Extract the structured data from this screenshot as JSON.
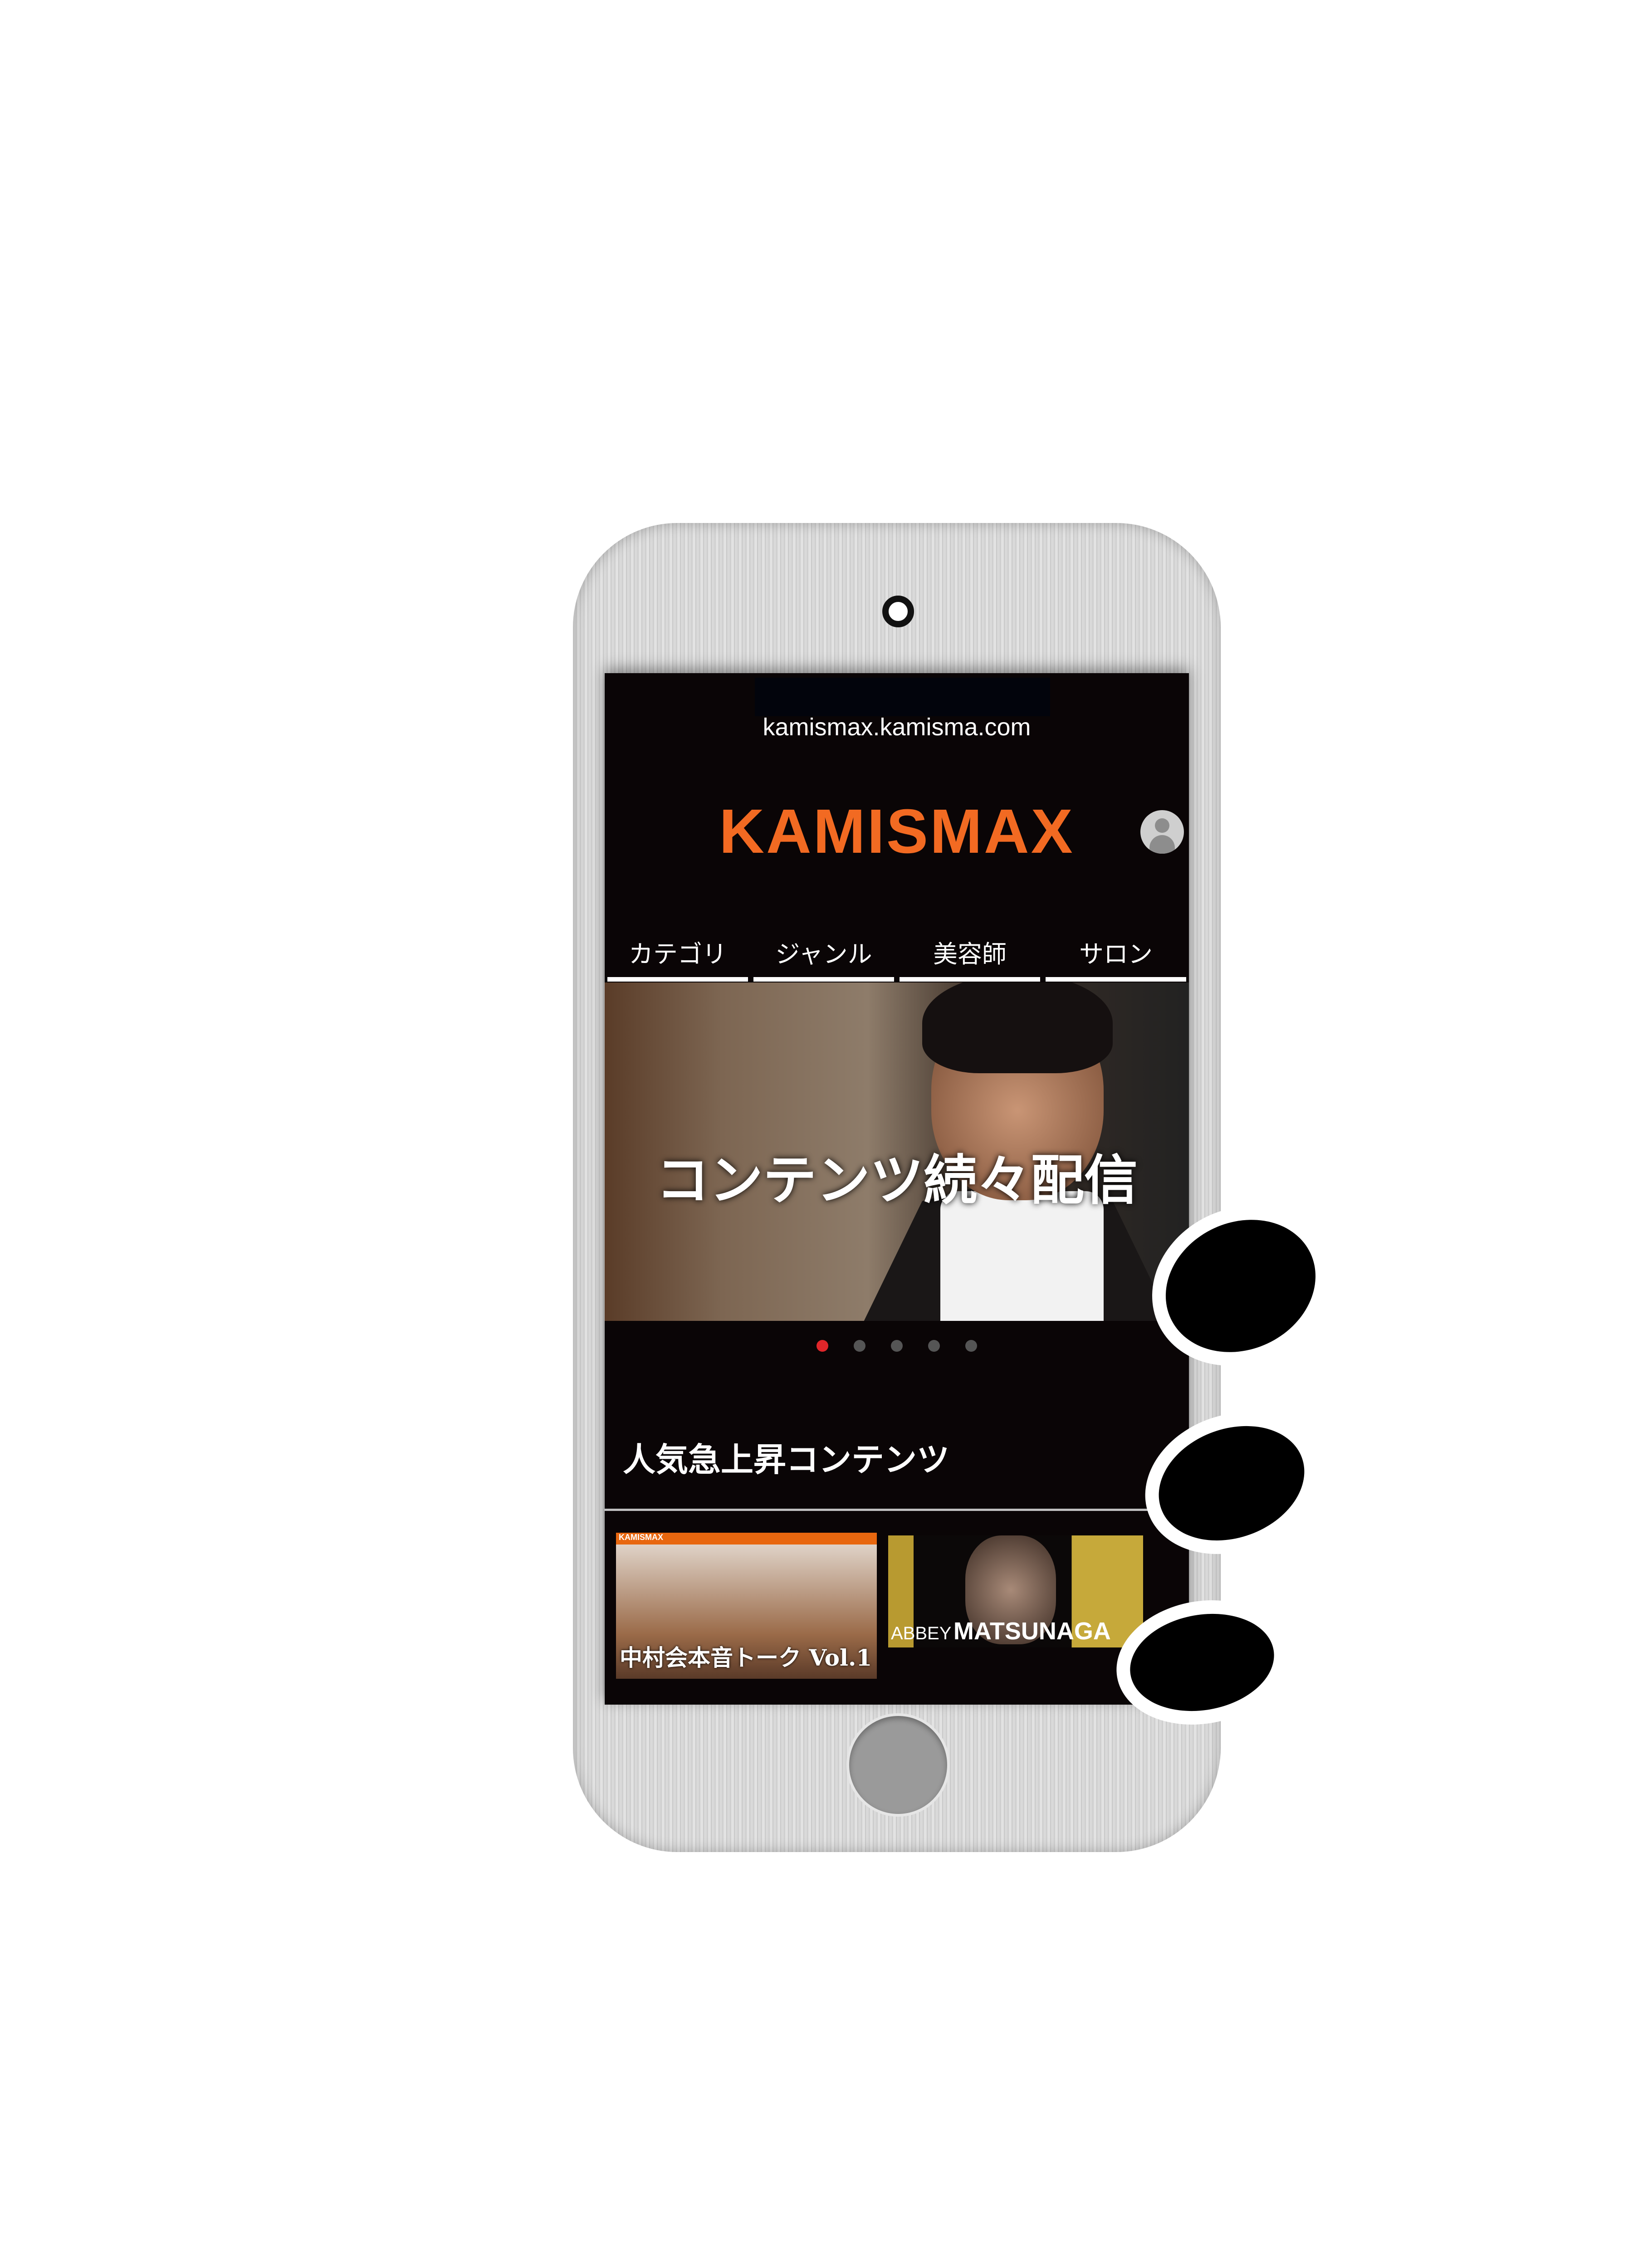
{
  "browser": {
    "url": "kamismax.kamisma.com"
  },
  "header": {
    "logo": "KAMISMAX",
    "avatar_icon": "user-avatar-icon"
  },
  "nav": {
    "tabs": [
      {
        "label": "カテゴリ"
      },
      {
        "label": "ジャンル"
      },
      {
        "label": "美容師"
      },
      {
        "label": "サロン"
      }
    ]
  },
  "hero": {
    "caption": "コンテンツ続々配信",
    "slide_count": 5,
    "active_slide": 1
  },
  "section": {
    "title": "人気急上昇コンテンツ"
  },
  "thumbnails": [
    {
      "brand": "KAMISMAX",
      "caption": "中村会本音トーク Vol.1"
    },
    {
      "caption_small": "ABBEY",
      "caption_large": "MATSUNAGA"
    }
  ],
  "colors": {
    "brand": "#f26a22",
    "background": "#0a0506",
    "active_dot": "#e0262a"
  }
}
